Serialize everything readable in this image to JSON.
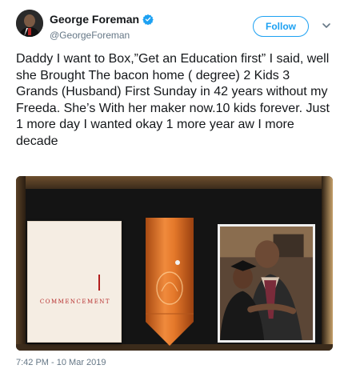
{
  "author": {
    "display_name": "George Foreman",
    "handle": "@GeorgeForeman",
    "verified": true
  },
  "actions": {
    "follow_label": "Follow",
    "more_icon": "chevron-down-icon"
  },
  "tweet": {
    "text": "Daddy I want to Box,”Get an Education first” I said, well she Brought The bacon home ( degree) 2 Kids 3 Grands (Husband) First Sunday in 42 years without my Freeda. She’s With her maker now.10 kids forever. Just 1 more day I wanted okay 1 more year aw I more decade",
    "timestamp": "7:42 PM - 10 Mar 2019"
  },
  "media": {
    "diploma_text": "COMMENCEMENT"
  },
  "colors": {
    "accent": "#1da1f2",
    "text": "#14171a",
    "secondary": "#657786"
  }
}
